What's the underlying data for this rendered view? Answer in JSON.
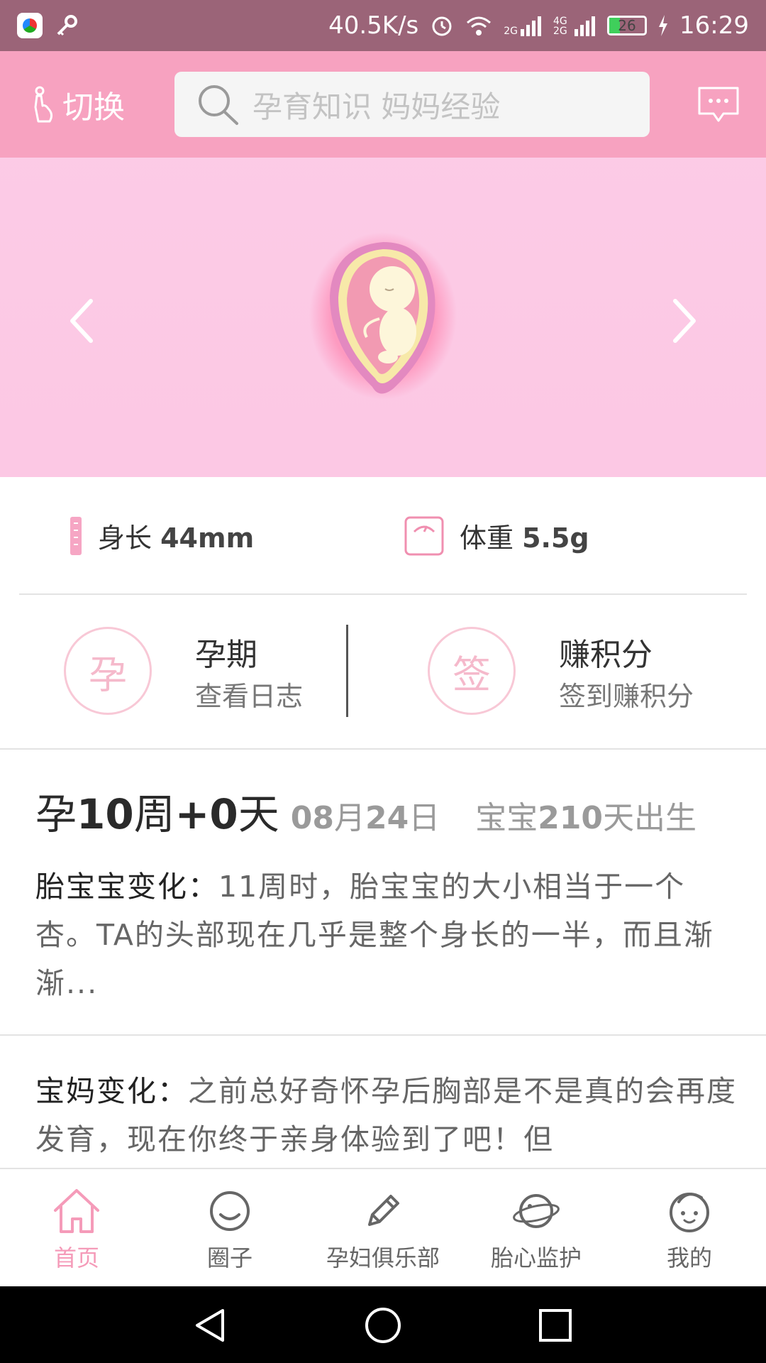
{
  "status_bar": {
    "speed": "40.5K/s",
    "signal_2g": "2G",
    "signal_4g": "4G 2G",
    "battery": "26",
    "time": "16:29"
  },
  "header": {
    "switch_label": "切换",
    "search_placeholder": "孕育知识 妈妈经验"
  },
  "measurements": {
    "length_label": "身长",
    "length_value": "44mm",
    "weight_label": "体重",
    "weight_value": "5.5g"
  },
  "actions": [
    {
      "icon_char": "孕",
      "title": "孕期",
      "subtitle": "查看日志"
    },
    {
      "icon_char": "签",
      "title": "赚积分",
      "subtitle": "签到赚积分"
    }
  ],
  "week_info": {
    "prefix": "孕",
    "weeks": "10",
    "week_unit": "周",
    "plus_days": "+0",
    "day_unit": "天",
    "date_month": "08",
    "month_unit": "月",
    "date_day": "24",
    "day_suffix": "日",
    "born_prefix": "宝宝",
    "born_days": "210",
    "born_suffix": "天出生"
  },
  "baby_change": {
    "label": "胎宝宝变化：",
    "text": "11周时，胎宝宝的大小相当于一个杏。TA的头部现在几乎是整个身长的一半，而且渐渐..."
  },
  "mom_change": {
    "label": "宝妈变化：",
    "text": "之前总好奇怀孕后胸部是不是真的会再度发育，现在你终于亲身体验到了吧！但"
  },
  "bottom_nav": [
    {
      "label": "首页",
      "icon": "home-icon",
      "active": true
    },
    {
      "label": "圈子",
      "icon": "circle-chat-icon",
      "active": false
    },
    {
      "label": "孕妇俱乐部",
      "icon": "pencil-icon",
      "active": false
    },
    {
      "label": "胎心监护",
      "icon": "planet-icon",
      "active": false
    },
    {
      "label": "我的",
      "icon": "baby-face-icon",
      "active": false
    }
  ],
  "colors": {
    "status_bar": "#9b6478",
    "header": "#f7a2c0",
    "banner": "#fcc7e3",
    "accent": "#f59bb9"
  }
}
